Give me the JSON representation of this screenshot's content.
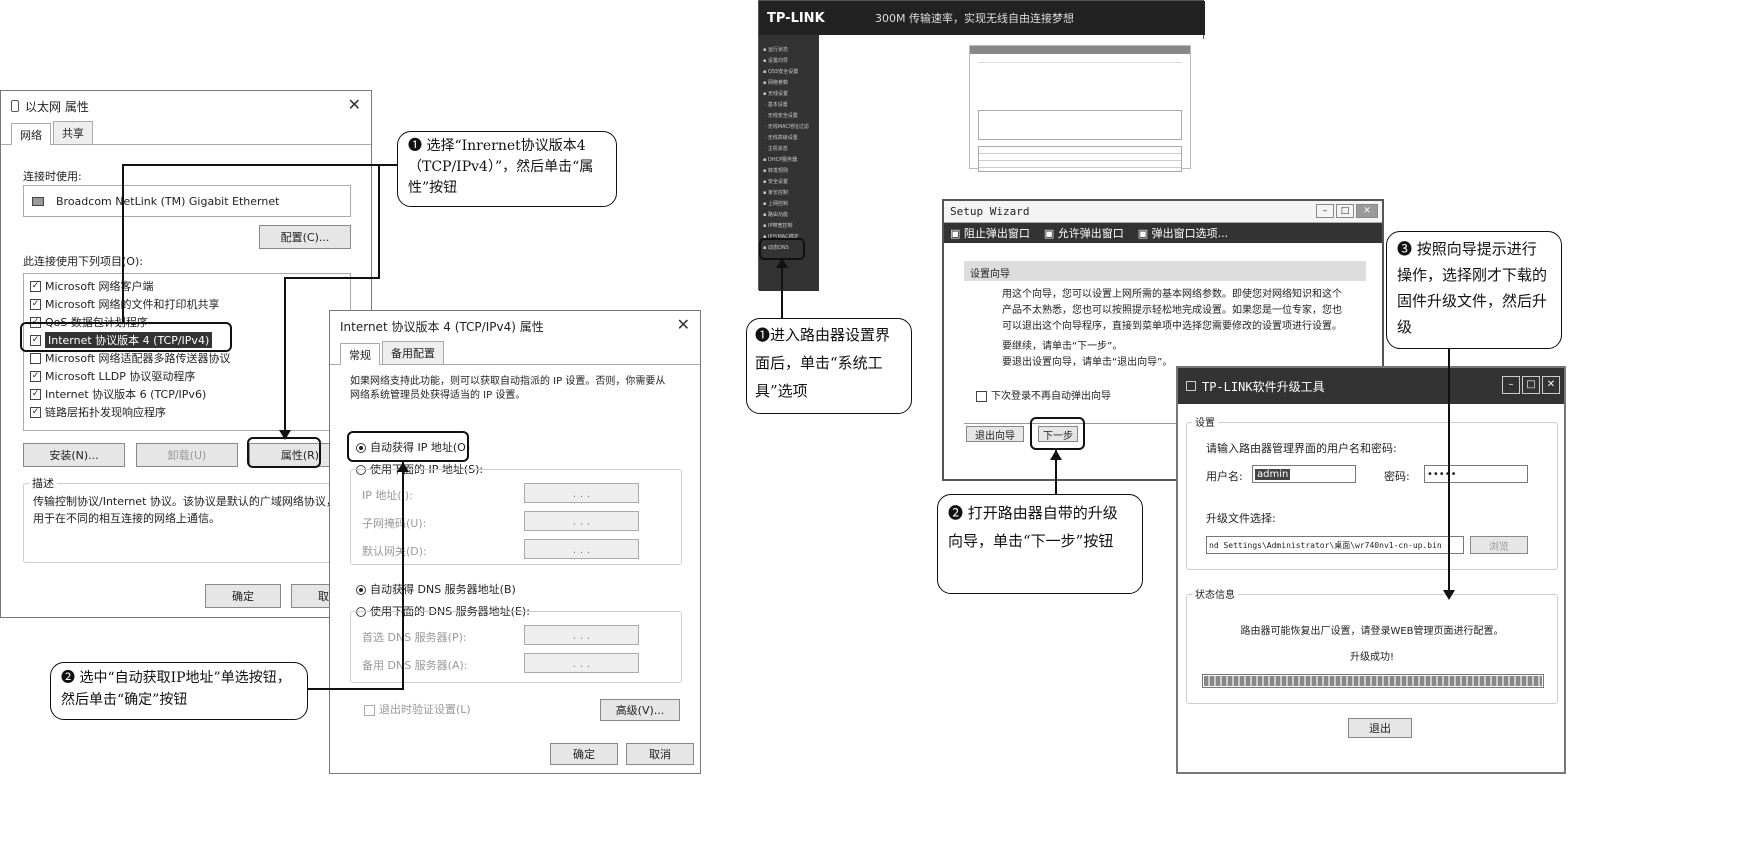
{
  "ethernet": {
    "title": "以太网 属性",
    "tabs": [
      "网络",
      "共享"
    ],
    "connect_using_label": "连接时使用:",
    "adapter": "Broadcom NetLink (TM) Gigabit Ethernet",
    "configure_btn": "配置(C)...",
    "items_label": "此连接使用下列项目(O):",
    "items": [
      {
        "label": "Microsoft 网络客户端",
        "checked": true
      },
      {
        "label": "Microsoft 网络的文件和打印机共享",
        "checked": true
      },
      {
        "label": "QoS 数据包计划程序",
        "checked": true
      },
      {
        "label": "Internet 协议版本 4 (TCP/IPv4)",
        "checked": true
      },
      {
        "label": "Microsoft 网络适配器多路传送器协议",
        "checked": false
      },
      {
        "label": "Microsoft LLDP 协议驱动程序",
        "checked": true
      },
      {
        "label": "Internet 协议版本 6 (TCP/IPv6)",
        "checked": true
      },
      {
        "label": "链路层拓扑发现响应程序",
        "checked": true
      }
    ],
    "install_btn": "安装(N)...",
    "uninstall_btn": "卸载(U)",
    "properties_btn": "属性(R)",
    "desc_label": "描述",
    "desc_text": "传输控制协议/Internet 协议。该协议是默认的广域网络协议，用于在不同的相互连接的网络上通信。",
    "ok_btn": "确定",
    "cancel_btn": "取消"
  },
  "ipv4": {
    "title": "Internet 协议版本 4 (TCP/IPv4) 属性",
    "tabs": [
      "常规",
      "备用配置"
    ],
    "intro": "如果网络支持此功能，则可以获取自动指派的 IP 设置。否则，你需要从网络系统管理员处获得适当的 IP 设置。",
    "auto_ip": "自动获得 IP 地址(O)",
    "manual_ip": "使用下面的 IP 地址(S):",
    "ip_label": "IP 地址(I):",
    "mask_label": "子网掩码(U):",
    "gw_label": "默认网关(D):",
    "auto_dns": "自动获得 DNS 服务器地址(B)",
    "manual_dns": "使用下面的 DNS 服务器地址(E):",
    "dns1_label": "首选 DNS 服务器(P):",
    "dns2_label": "备用 DNS 服务器(A):",
    "validate": "退出时验证设置(L)",
    "advanced_btn": "高级(V)...",
    "ok_btn": "确定",
    "cancel_btn": "取消",
    "ip_dots": ".   .   ."
  },
  "callouts": {
    "c1": "❶ 选择“Inrernet协议版本4（TCP/IPv4）”，然后单击“属性”按钮",
    "c2": "❷ 选中“自动获取IP地址”单选按钮，然后单击“确定”按钮",
    "c3": "❶进入路由器设置界面后，单击“系统工具”选项",
    "c4": "❷ 打开路由器自带的升级向导，单击“下一步”按钮",
    "c5": "❸ 按照向导提示进行操作，选择刚才下载的固件升级文件，然后升级"
  },
  "router": {
    "logo": "TP-LINK",
    "banner": "300M 传输速率，实现无线自由连接梦想"
  },
  "wizard": {
    "title": "Setup Wizard",
    "toolbar": [
      "阻止弹出窗口",
      "允许弹出窗口",
      "弹出窗口选项..."
    ],
    "header": "设置向导",
    "body1": "用这个向导，您可以设置上网所需的基本网络参数。即使您对网络知识和这个产品不太熟悉，您也可以按照提示轻松地完成设置。如果您是一位专家，您也可以退出这个向导程序，直接到菜单项中选择您需要修改的设置项进行设置。",
    "body2": "要继续，请单击“下一步”。",
    "body3": "要退出设置向导，请单击“退出向导”。",
    "no_popup": "下次登录不再自动弹出向导",
    "exit_btn": "退出向导",
    "next_btn": "下一步"
  },
  "upgrade": {
    "title": "TP-LINK软件升级工具",
    "settings_label": "设置",
    "prompt": "请输入路由器管理界面的用户名和密码:",
    "user_label": "用户名:",
    "user_value": "admin",
    "pwd_label": "密码:",
    "pwd_value": "•••••",
    "file_label": "升级文件选择:",
    "file_value": "nd Settings\\Administrator\\桌面\\wr740nv1-cn-up.bin",
    "browse_btn": "浏览",
    "status_label": "状态信息",
    "status1": "路由器可能恢复出厂设置，请登录WEB管理页面进行配置。",
    "status2": "升级成功!",
    "progress": 1.0,
    "exit_btn": "退出"
  }
}
